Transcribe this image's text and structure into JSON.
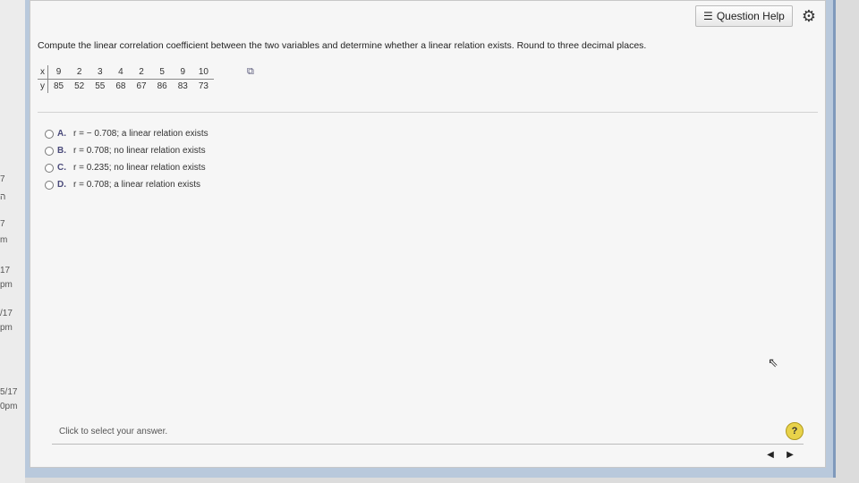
{
  "left_strip": [
    "7",
    "ה",
    "7",
    "m",
    "17",
    "pm",
    "/17",
    "pm",
    "5/17",
    "0pm"
  ],
  "header": {
    "help_label": "Question Help"
  },
  "question": {
    "text": "Compute the linear correlation coefficient between the two variables and determine whether a linear relation exists. Round to three decimal places."
  },
  "table": {
    "x_label": "x",
    "y_label": "y",
    "x": [
      "9",
      "2",
      "3",
      "4",
      "2",
      "5",
      "9",
      "10"
    ],
    "y": [
      "85",
      "52",
      "55",
      "68",
      "67",
      "86",
      "83",
      "73"
    ]
  },
  "options": [
    {
      "letter": "A.",
      "text": "r = − 0.708; a linear relation exists"
    },
    {
      "letter": "B.",
      "text": "r = 0.708; no linear relation exists"
    },
    {
      "letter": "C.",
      "text": "r = 0.235; no linear relation exists"
    },
    {
      "letter": "D.",
      "text": "r = 0.708; a linear relation exists"
    }
  ],
  "footer": {
    "instruction": "Click to select your answer.",
    "help_symbol": "?"
  },
  "icons": {
    "list": "list-icon",
    "gear": "gear-icon",
    "copy": "copy-icon",
    "prev": "prev-icon",
    "next": "next-icon"
  }
}
